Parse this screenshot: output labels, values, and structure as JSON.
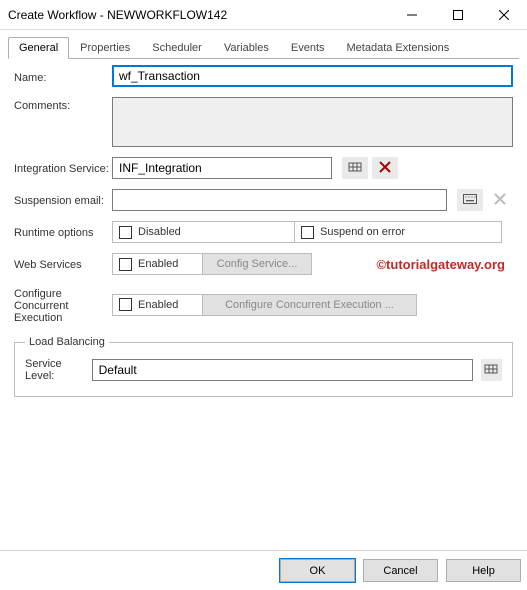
{
  "window": {
    "title": "Create Workflow - NEWWORKFLOW142"
  },
  "tabs": {
    "general": "General",
    "properties": "Properties",
    "scheduler": "Scheduler",
    "variables": "Variables",
    "events": "Events",
    "metadata": "Metadata Extensions"
  },
  "labels": {
    "name": "Name:",
    "comments": "Comments:",
    "integration_service": "Integration Service:",
    "suspension_email": "Suspension email:",
    "runtime_options": "Runtime options",
    "disabled": "Disabled",
    "suspend_on_error": "Suspend on error",
    "web_services": "Web Services",
    "enabled": "Enabled",
    "config_service": "Config Service...",
    "configure_concurrent_execution_lbl": "Configure Concurrent Execution",
    "configure_concurrent_execution_btn": "Configure Concurrent Execution ...",
    "load_balancing": "Load Balancing",
    "service_level": "Service Level:"
  },
  "values": {
    "name": "wf_Transaction",
    "comments": "",
    "integration_service": "INF_Integration",
    "suspension_email": "",
    "service_level": "Default"
  },
  "footer": {
    "ok": "OK",
    "cancel": "Cancel",
    "help": "Help"
  },
  "watermark": "©tutorialgateway.org"
}
